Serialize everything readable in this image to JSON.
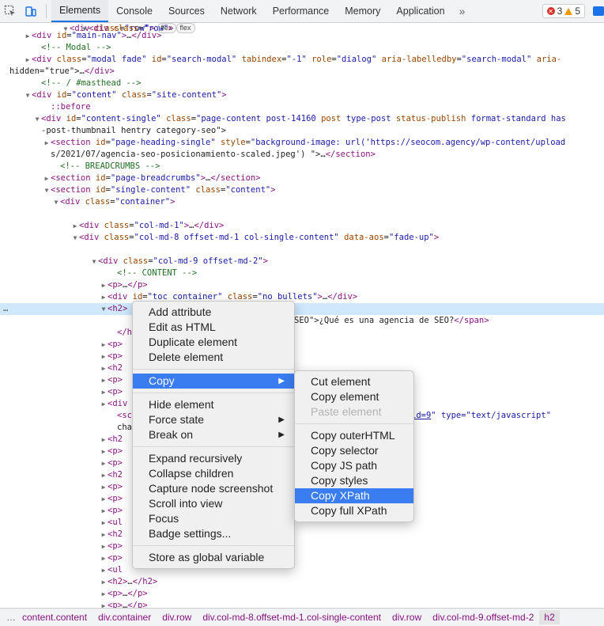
{
  "toolbar": {
    "tabs": [
      "Elements",
      "Console",
      "Sources",
      "Network",
      "Performance",
      "Memory",
      "Application"
    ],
    "more": "»",
    "error_count": "3",
    "warning_count": "5"
  },
  "tree_lines": [
    {
      "t": "<!-- / #sidebar-page -->"
    },
    {
      "a": "<div id=\"main-nav\">…</div>"
    },
    {
      "t": "<!-- Modal -->"
    },
    {
      "a": "<div class=\"modal fade\" id=\"search-modal\" tabindex=\"-1\" role=\"dialog\" aria-labelledby=\"search-modal\" aria-"
    },
    {
      "t": "hidden=\"true\">…</div>"
    },
    {
      "t": "<!-- / #masthead -->"
    },
    {
      "a": "<div id=\"content\" class=\"site-content\">"
    },
    {
      "t": "::before"
    },
    {
      "a": "<div id=\"content-single\" class=\"page-content post-14160 post type-post status-publish format-standard has"
    },
    {
      "t": "-post-thumbnail hentry category-seo\">"
    },
    {
      "a": "<section id=\"page-heading-single\" style=\"background-image: url('https://seocom.agency/wp-content/upload"
    },
    {
      "t": "s/2021/07/agencia-seo-posicionamiento-scaled.jpeg') \">…</section>"
    },
    {
      "t": "<!-- BREADCRUMBS -->"
    },
    {
      "a": "<section id=\"page-breadcrumbs\">…</section>"
    },
    {
      "a": "<section id=\"single-content\" class=\"content\">"
    },
    {
      "a": "<div class=\"container\">"
    },
    {
      "a": "<div class=\"row\">"
    },
    {
      "a": "<div class=\"col-md-1\">…</div>"
    },
    {
      "a": "<div class=\"col-md-8 offset-md-1 col-single-content\" data-aos=\"fade-up\">"
    },
    {
      "a": "<div class=\"row\">"
    },
    {
      "a": "<div class=\"col-md-9 offset-md-2\">"
    },
    {
      "t": "<!-- CONTENT -->"
    },
    {
      "a": "<p>…</p>"
    },
    {
      "a": "<div id=\"toc_container\" class=\"no_bullets\">…</div>"
    },
    {
      "a": "<h2>"
    },
    {
      "t": "SEO\">¿Qué es una agencia de SEO?</span>"
    },
    {
      "t": "</h2>"
    },
    {
      "a": "<p>"
    },
    {
      "a": "<p>"
    },
    {
      "a": "<h2"
    },
    {
      "a": "<p>"
    },
    {
      "a": "<p>"
    },
    {
      "a": "<div"
    },
    {
      "t": "<sc",
      "tail_link": "id=9",
      "tail_rest": "\" type=\"text/javascript\""
    },
    {
      "t": "cha"
    },
    {
      "a": "<h2"
    },
    {
      "a": "<p>"
    },
    {
      "a": "<p>"
    },
    {
      "a": "<h2"
    },
    {
      "a": "<p>"
    },
    {
      "a": "<p>"
    },
    {
      "a": "<p>"
    },
    {
      "a": "<ul"
    },
    {
      "a": "<h2"
    },
    {
      "a": "<p>"
    },
    {
      "a": "<p>"
    },
    {
      "a": "<ul"
    },
    {
      "a": "<h2>…</h2>"
    },
    {
      "a": "<p>…</p>"
    },
    {
      "a": "<p>…</p>"
    }
  ],
  "badges": {
    "flex": "flex"
  },
  "selected_ellipsis": "…",
  "context_menu": {
    "items": [
      "Add attribute",
      "Edit as HTML",
      "Duplicate element",
      "Delete element"
    ],
    "copy": "Copy",
    "items2": [
      "Hide element",
      "Force state",
      "Break on"
    ],
    "items3": [
      "Expand recursively",
      "Collapse children",
      "Capture node screenshot",
      "Scroll into view",
      "Focus",
      "Badge settings..."
    ],
    "items4": [
      "Store as global variable"
    ]
  },
  "copy_submenu": {
    "group1": [
      "Cut element",
      "Copy element",
      "Paste element"
    ],
    "group2": [
      "Copy outerHTML",
      "Copy selector",
      "Copy JS path",
      "Copy styles",
      "Copy XPath",
      "Copy full XPath"
    ]
  },
  "breadcrumbs": {
    "more": "…",
    "items": [
      "content.content",
      "div.container",
      "div.row",
      "div.col-md-8.offset-md-1.col-single-content",
      "div.row",
      "div.col-md-9.offset-md-2",
      "h2"
    ]
  }
}
